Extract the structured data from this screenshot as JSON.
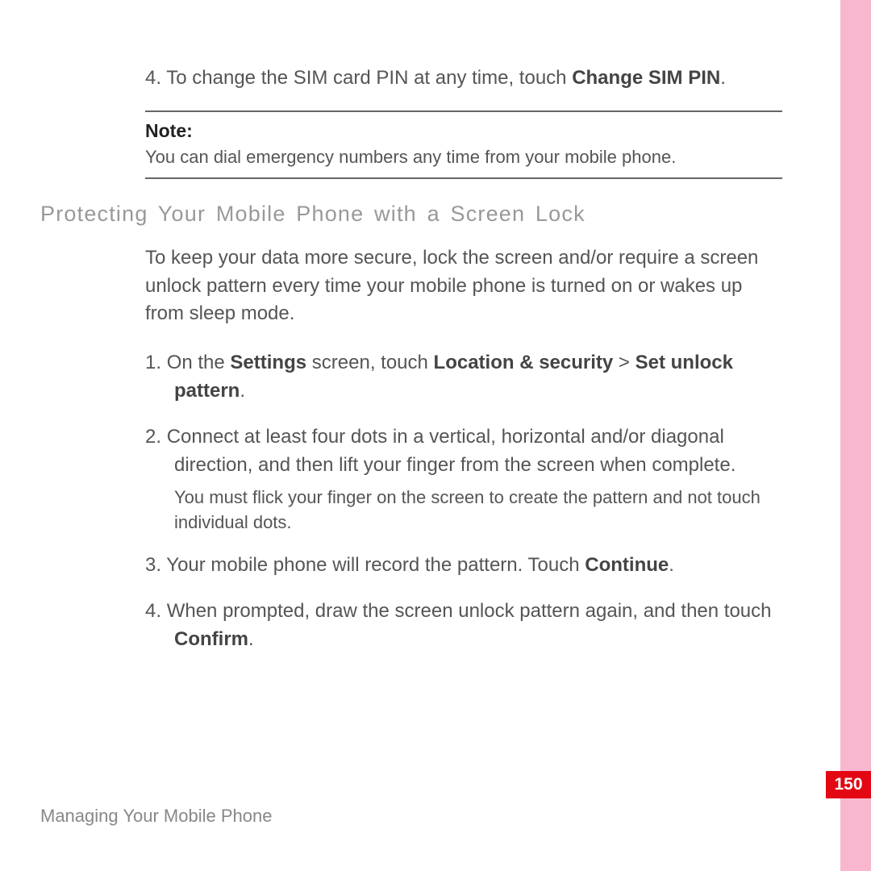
{
  "prev_step4": {
    "number": "4",
    "pre": "To change the SIM card PIN at any time, touch ",
    "bold": "Change SIM PIN",
    "post": "."
  },
  "note": {
    "label": "Note:",
    "text": "You can dial emergency numbers any time from your mobile phone."
  },
  "section_heading": "Protecting  Your  Mobile  Phone  with  a  Screen  Lock",
  "intro": "To keep your data more secure, lock the screen and/or require a screen unlock pattern every time your mobile phone is turned on or wakes up from sleep mode.",
  "steps": {
    "s1": {
      "number": "1",
      "pre": "On the ",
      "b1": "Settings",
      "mid1": " screen, touch ",
      "b2": "Location & security",
      "mid2": " > ",
      "b3": "Set unlock pattern",
      "post": "."
    },
    "s2": {
      "number": "2",
      "text": "Connect at least four dots in a vertical, horizontal and/or diagonal direction, and then lift your finger from the screen when complete.",
      "subnote": "You must flick your finger on the screen to create the pattern and not touch individual dots."
    },
    "s3": {
      "number": "3",
      "pre": "Your mobile phone will record the pattern. Touch ",
      "b1": "Continue",
      "post": "."
    },
    "s4": {
      "number": "4",
      "pre": "When prompted, draw the screen unlock pattern again, and then touch ",
      "b1": "Confirm",
      "post": "."
    }
  },
  "footer": "Managing Your Mobile Phone",
  "page_number": "150"
}
